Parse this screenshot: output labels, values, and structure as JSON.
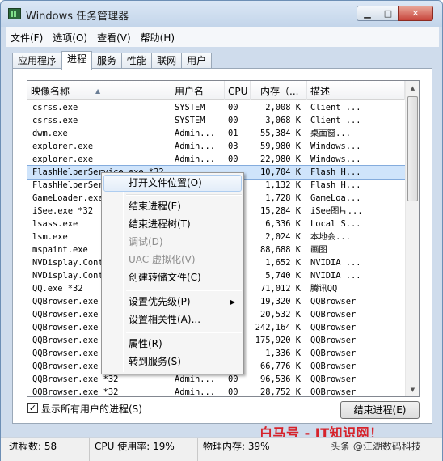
{
  "window": {
    "title": "Windows 任务管理器",
    "min_label": "▁",
    "max_label": "□",
    "close_label": "✕"
  },
  "menu": [
    "文件(F)",
    "选项(O)",
    "查看(V)",
    "帮助(H)"
  ],
  "tabs": [
    {
      "label": "应用程序",
      "active": false
    },
    {
      "label": "进程",
      "active": true
    },
    {
      "label": "服务",
      "active": false
    },
    {
      "label": "性能",
      "active": false
    },
    {
      "label": "联网",
      "active": false
    },
    {
      "label": "用户",
      "active": false
    }
  ],
  "columns": {
    "name": "映像名称",
    "user": "用户名",
    "cpu": "CPU",
    "mem": "内存（...",
    "desc": "描述"
  },
  "processes": [
    {
      "name": "csrss.exe",
      "user": "SYSTEM",
      "cpu": "00",
      "mem": "2,008 K",
      "desc": "Client ..."
    },
    {
      "name": "csrss.exe",
      "user": "SYSTEM",
      "cpu": "00",
      "mem": "3,068 K",
      "desc": "Client ..."
    },
    {
      "name": "dwm.exe",
      "user": "Admin...",
      "cpu": "01",
      "mem": "55,384 K",
      "desc": "桌面窗..."
    },
    {
      "name": "explorer.exe",
      "user": "Admin...",
      "cpu": "03",
      "mem": "59,980 K",
      "desc": "Windows..."
    },
    {
      "name": "explorer.exe",
      "user": "Admin...",
      "cpu": "00",
      "mem": "22,980 K",
      "desc": "Windows..."
    },
    {
      "name": "FlashHelperService.exe *32",
      "user": "",
      "cpu": "",
      "mem": "10,704 K",
      "desc": "Flash H...",
      "selected": true
    },
    {
      "name": "FlashHelperService.exe",
      "user": "",
      "cpu": "",
      "mem": "1,132 K",
      "desc": "Flash H..."
    },
    {
      "name": "GameLoader.exe",
      "user": "",
      "cpu": "",
      "mem": "1,728 K",
      "desc": "GameLoa..."
    },
    {
      "name": "iSee.exe *32",
      "user": "",
      "cpu": "",
      "mem": "15,284 K",
      "desc": "iSee图片..."
    },
    {
      "name": "lsass.exe",
      "user": "",
      "cpu": "",
      "mem": "6,336 K",
      "desc": "Local S..."
    },
    {
      "name": "lsm.exe",
      "user": "",
      "cpu": "",
      "mem": "2,024 K",
      "desc": "本地会..."
    },
    {
      "name": "mspaint.exe",
      "user": "",
      "cpu": "",
      "mem": "88,688 K",
      "desc": "画图"
    },
    {
      "name": "NVDisplay.Container.exe",
      "user": "",
      "cpu": "",
      "mem": "1,652 K",
      "desc": "NVIDIA ..."
    },
    {
      "name": "NVDisplay.Container.exe",
      "user": "",
      "cpu": "",
      "mem": "5,740 K",
      "desc": "NVIDIA ..."
    },
    {
      "name": "QQ.exe *32",
      "user": "",
      "cpu": "",
      "mem": "71,012 K",
      "desc": "腾讯QQ"
    },
    {
      "name": "QQBrowser.exe",
      "user": "",
      "cpu": "",
      "mem": "19,320 K",
      "desc": "QQBrowser"
    },
    {
      "name": "QQBrowser.exe",
      "user": "",
      "cpu": "",
      "mem": "20,532 K",
      "desc": "QQBrowser"
    },
    {
      "name": "QQBrowser.exe",
      "user": "",
      "cpu": "",
      "mem": "242,164 K",
      "desc": "QQBrowser"
    },
    {
      "name": "QQBrowser.exe",
      "user": "",
      "cpu": "",
      "mem": "175,920 K",
      "desc": "QQBrowser"
    },
    {
      "name": "QQBrowser.exe",
      "user": "",
      "cpu": "",
      "mem": "1,336 K",
      "desc": "QQBrowser"
    },
    {
      "name": "QQBrowser.exe",
      "user": "",
      "cpu": "",
      "mem": "66,776 K",
      "desc": "QQBrowser"
    },
    {
      "name": "QQBrowser.exe *32",
      "user": "Admin...",
      "cpu": "00",
      "mem": "96,536 K",
      "desc": "QQBrowser"
    },
    {
      "name": "QQBrowser.exe *32",
      "user": "Admin...",
      "cpu": "00",
      "mem": "28,752 K",
      "desc": "QQBrowser"
    }
  ],
  "context_menu": {
    "open_location": "打开文件位置(O)",
    "end_process": "结束进程(E)",
    "end_tree": "结束进程树(T)",
    "debug": "调试(D)",
    "uac": "UAC 虚拟化(V)",
    "dump": "创建转储文件(C)",
    "priority": "设置优先级(P)",
    "affinity": "设置相关性(A)...",
    "properties": "属性(R)",
    "goto_service": "转到服务(S)"
  },
  "show_all_users": {
    "label": "显示所有用户的进程(S)",
    "checked": true,
    "mark": "✓"
  },
  "end_process_button": "结束进程(E)",
  "status": {
    "process_count": "进程数: 58",
    "cpu": "CPU 使用率: 19%",
    "memory": "物理内存: 39%"
  },
  "watermark": "白马号 - IT知识网！",
  "credit": "头条 @江湖数码科技"
}
